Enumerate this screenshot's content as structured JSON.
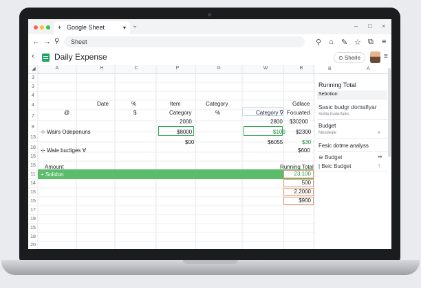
{
  "browser": {
    "tab_title": "Google Sheet",
    "address": "Sheet",
    "controls": [
      "–",
      "□",
      "×"
    ]
  },
  "header": {
    "title": "Daily Expense",
    "share_label": "Sherle"
  },
  "grid": {
    "columns": [
      "A",
      "H",
      "C",
      "P",
      "G",
      "W",
      "B"
    ],
    "panel_columns": [
      "B",
      "A"
    ],
    "row_numbers": [
      "3",
      "3",
      "4",
      "4",
      "7",
      "8",
      "13",
      "18",
      "15",
      "15",
      "11",
      "14",
      "15",
      "15",
      "17",
      "19",
      "15",
      "18",
      "20"
    ],
    "header_row": {
      "date": "Date",
      "pct": "%",
      "item": "Item",
      "category": "Category",
      "gdlace": "Gdlace"
    },
    "row2": {
      "at": "@",
      "s": "$",
      "category": "Category",
      "pct": "%",
      "category_filter": "Category ∇",
      "focused": "Focuated"
    },
    "row3": {
      "item_val": "2000",
      "w_val": "2800",
      "b_val": "$30200"
    },
    "row4": {
      "label": "Wairs Odepenuns",
      "item_val": "$8000",
      "w_val": "$100",
      "b_val": "$2300"
    },
    "row5": {
      "item_val": "$00",
      "w_val": "$6055",
      "b_val": "$30"
    },
    "row6": {
      "label": "Waie bucliges ∀",
      "b_val": "$600"
    },
    "amount_label": "Amount",
    "running_total_label": "Running Total",
    "green_row_label": "Solidon",
    "running_values": [
      "23.100",
      "500",
      "2.2000",
      "$900"
    ]
  },
  "panel": {
    "title": "Running Total",
    "selected": "Sebotion",
    "item1": "Sasic budgr domaflyar",
    "item1_sub": "Sidde buderfaiks",
    "budget": "Budget",
    "budget_sub": "Mesdeale",
    "budget_arrow": "»",
    "analysis": "Fesic dotme analyss",
    "budget2": "Budget",
    "basic": "Beic Budget"
  }
}
